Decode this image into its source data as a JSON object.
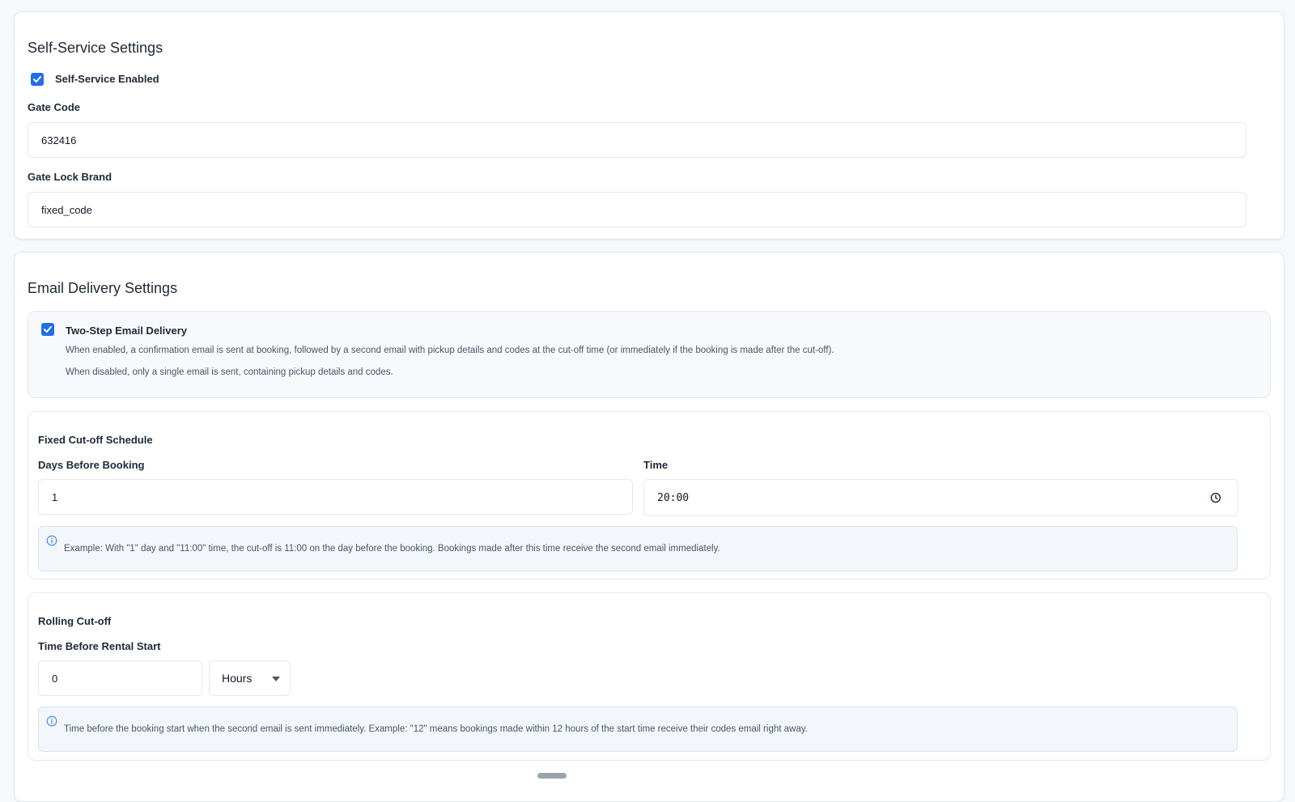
{
  "self_service": {
    "title": "Self-Service Settings",
    "enabled_label": "Self-Service Enabled",
    "enabled_checked": true,
    "gate_code_label": "Gate Code",
    "gate_code_value": "632416",
    "gate_lock_brand_label": "Gate Lock Brand",
    "gate_lock_brand_value": "fixed_code"
  },
  "email_delivery": {
    "title": "Email Delivery Settings",
    "two_step": {
      "label": "Two-Step Email Delivery",
      "checked": true,
      "desc_enabled": "When enabled, a confirmation email is sent at booking, followed by a second email with pickup details and codes at the cut-off time (or immediately if the booking is made after the cut-off).",
      "desc_disabled": "When disabled, only a single email is sent, containing pickup details and codes."
    },
    "fixed_cutoff": {
      "title": "Fixed Cut-off Schedule",
      "days_label": "Days Before Booking",
      "days_value": "1",
      "time_label": "Time",
      "time_value": "20:00",
      "info_text": "Example: With \"1\" day and \"11:00\" time, the cut-off is 11:00 on the day before the booking. Bookings made after this time receive the second email immediately."
    },
    "rolling_cutoff": {
      "title": "Rolling Cut-off",
      "time_before_label": "Time Before Rental Start",
      "time_before_value": "0",
      "unit_value": "Hours",
      "info_text": "Time before the booking start when the second email is sent immediately. Example: \"12\" means bookings made within 12 hours of the start time receive their codes email right away."
    }
  },
  "colors": {
    "accent": "#1f6feb",
    "border": "#e3e8ee",
    "info_bg": "#f3f7fc",
    "info_icon": "#3b82f6"
  },
  "icons": {
    "checkbox": "checkmark-icon",
    "clock": "clock-icon",
    "info": "info-icon",
    "dropdown": "caret-down-icon"
  }
}
